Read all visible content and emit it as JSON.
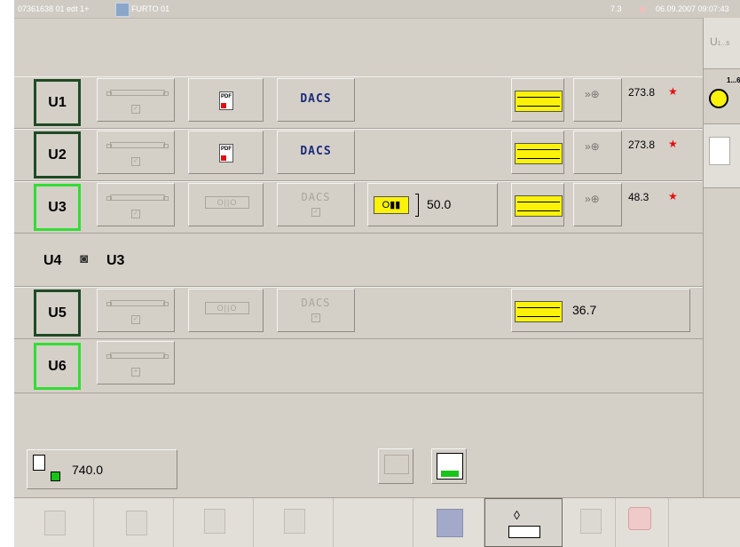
{
  "titlebar": {
    "left_text": "07361638 01 edt 1+",
    "doc_name": "FURTO 01",
    "center_text": "7.3",
    "datetime": "06.09.2007 09:07:43"
  },
  "side": {
    "u_tab_label": "U",
    "u_tab_range": "1...6",
    "roll_tab_range": "1...6"
  },
  "rows": {
    "u1": {
      "label": "U1",
      "value": "273.8",
      "star": "★"
    },
    "u2": {
      "label": "U2",
      "value": "273.8",
      "star": "★"
    },
    "u3": {
      "label": "U3",
      "value": "48.3",
      "star": "★",
      "perf_value": "50.0"
    },
    "u4": {
      "label": "U4",
      "link_target": "U3"
    },
    "u5": {
      "label": "U5",
      "value": "36.7"
    },
    "u6": {
      "label": "U6"
    }
  },
  "labels": {
    "dacs": "DACS",
    "pdf": "PDF",
    "perf_glyph": "O||O",
    "dacs_small": "DACS"
  },
  "footer": {
    "width_value": "740.0"
  },
  "colors": {
    "background": "#d4d0c8",
    "active_border": "#1f4a25",
    "inactive_border": "#33dd33",
    "highlight": "#fbf20a",
    "star": "#e31010",
    "dacs_text": "#1c2c7c"
  }
}
